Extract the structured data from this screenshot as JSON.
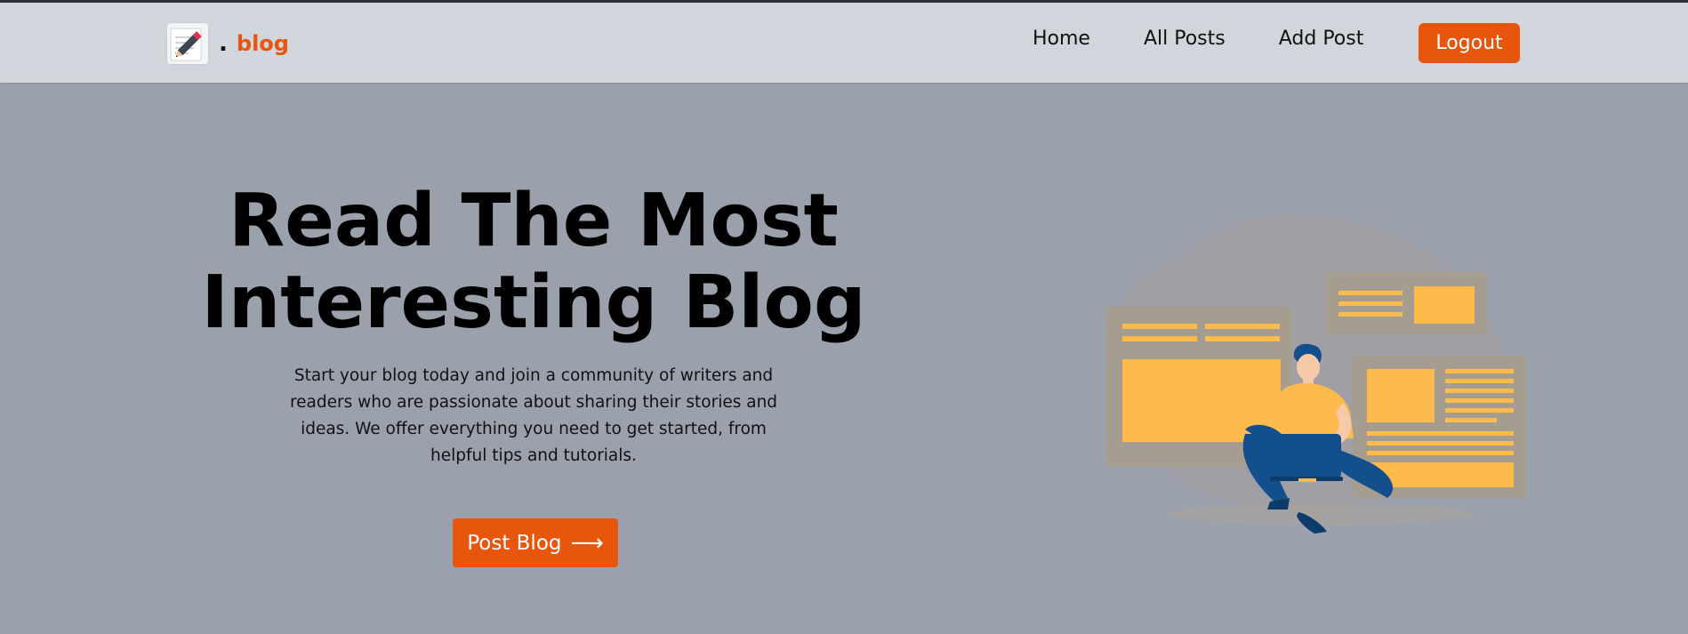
{
  "brand": {
    "dot": ".",
    "name": "blog",
    "logo_icon": "notepad-pencil-icon"
  },
  "nav": {
    "links": [
      "Home",
      "All Posts",
      "Add Post"
    ],
    "logout_label": "Logout"
  },
  "hero": {
    "title_line1": "Read The Most",
    "title_line2": "Interesting Blog",
    "description": "Start your blog today and join a community of writers and readers who are passionate about sharing their stories and ideas. We offer everything you need to get started, from helpful tips and tutorials.",
    "cta_label": "Post Blog",
    "cta_icon": "arrow-right-icon",
    "illustration": "person-with-laptop-blog-illustration"
  },
  "colors": {
    "accent": "#e8550d",
    "navbar_bg": "#d1d5dc",
    "page_bg": "#9aa1ad",
    "illustration_yellow": "#fdba4d",
    "illustration_blue": "#124f8c"
  }
}
